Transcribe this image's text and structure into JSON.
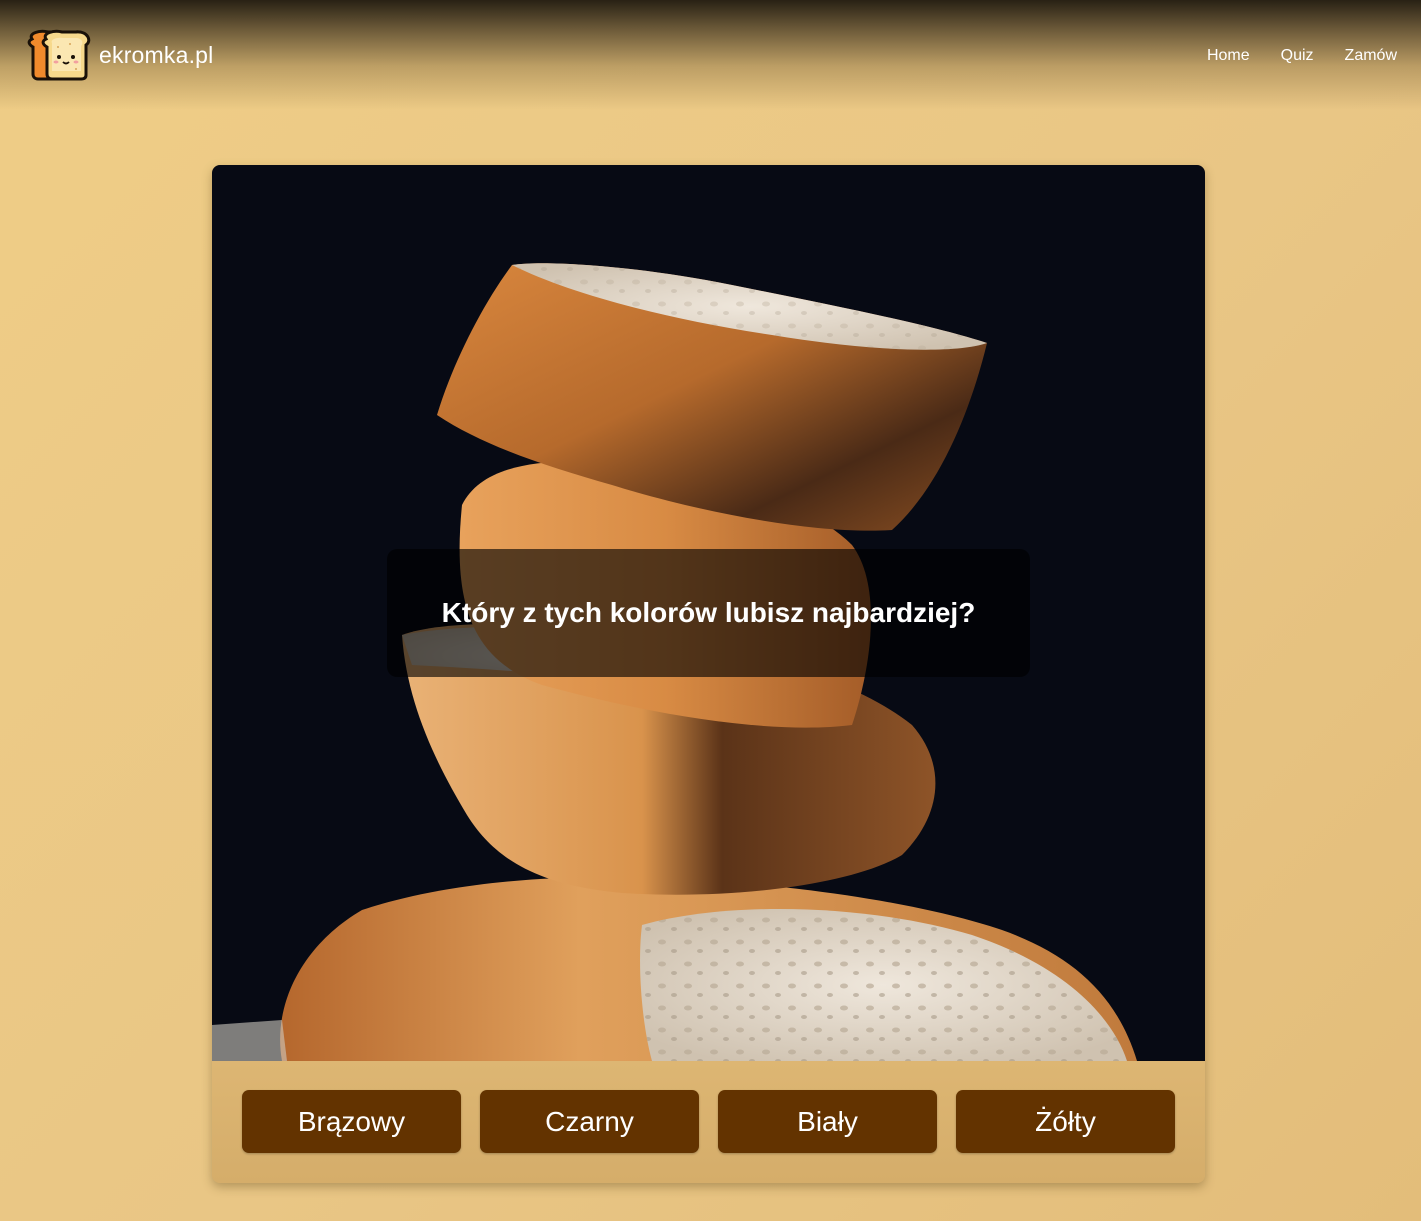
{
  "header": {
    "brand_name": "ekromka.pl",
    "logo_icon": "toast-logo-icon",
    "nav": [
      {
        "label": "Home"
      },
      {
        "label": "Quiz"
      },
      {
        "label": "Zamów"
      }
    ]
  },
  "quiz": {
    "image_subject": "stacked-bread-slices",
    "question": "Który z tych kolorów lubisz najbardziej?",
    "answers": [
      {
        "label": "Brązowy"
      },
      {
        "label": "Czarny"
      },
      {
        "label": "Biały"
      },
      {
        "label": "Żółty"
      }
    ]
  },
  "colors": {
    "page_background": "#efcd86",
    "button_background": "#633300",
    "button_text": "#ffffff",
    "hero_background": "#070a14"
  }
}
